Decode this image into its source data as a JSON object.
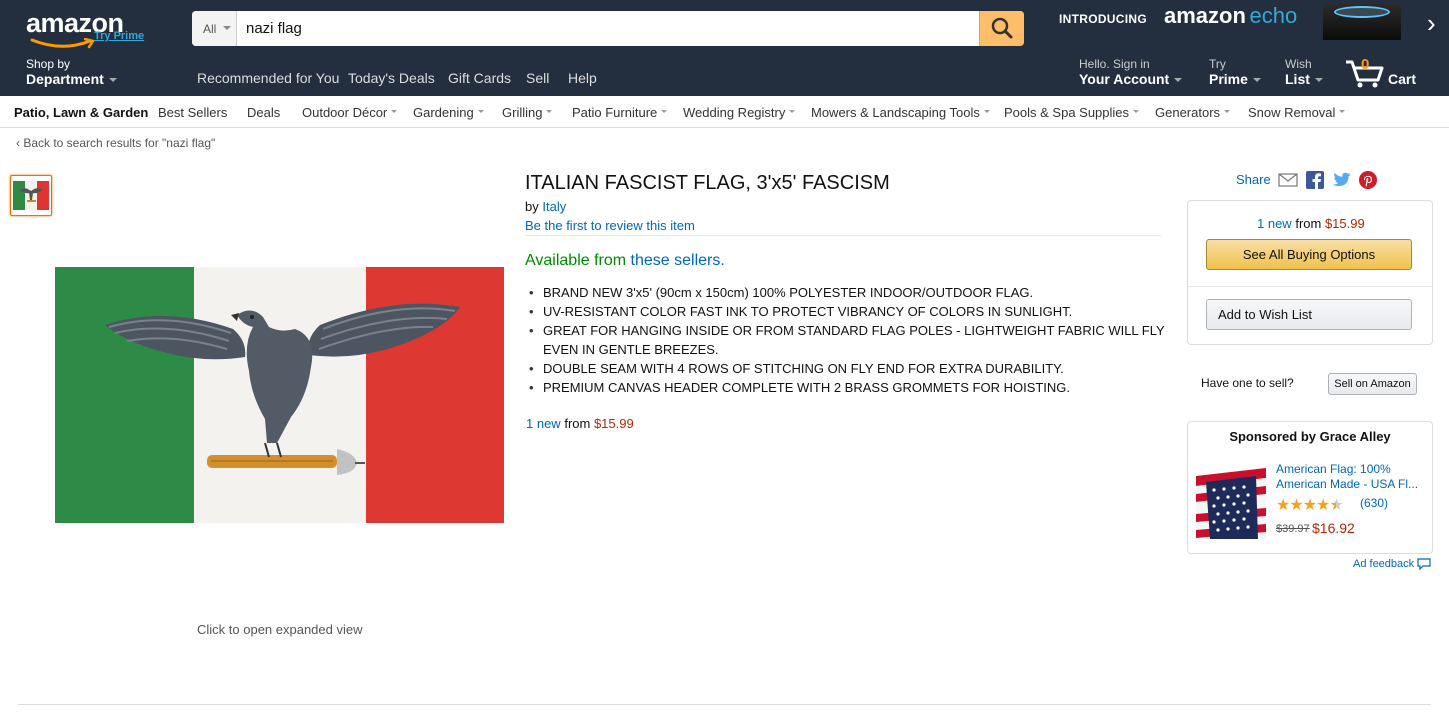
{
  "header": {
    "logo_text": "amazon",
    "logo_prime": "Try Prime",
    "search": {
      "scope": "All",
      "value": "nazi flag"
    },
    "promo": {
      "introducing": "INTRODUCING",
      "brand_1": "amazon",
      "brand_2": "echo",
      "arrow": "›"
    },
    "shop_by_small": "Shop by",
    "shop_by_big": "Department",
    "links": [
      "Recommended for You",
      "Today's Deals",
      "Gift Cards",
      "Sell",
      "Help"
    ],
    "account": {
      "small": "Hello. Sign in",
      "big": "Your Account"
    },
    "prime": {
      "small": "Try",
      "big": "Prime"
    },
    "wishlist": {
      "small": "Wish",
      "big": "List"
    },
    "cart": {
      "count": "0",
      "label": "Cart"
    }
  },
  "subnav": {
    "items": [
      {
        "label": "Patio, Lawn & Garden",
        "caret": false
      },
      {
        "label": "Best Sellers",
        "caret": false
      },
      {
        "label": "Deals",
        "caret": false
      },
      {
        "label": "Outdoor Décor",
        "caret": true
      },
      {
        "label": "Gardening",
        "caret": true
      },
      {
        "label": "Grilling",
        "caret": true
      },
      {
        "label": "Patio Furniture",
        "caret": true
      },
      {
        "label": "Wedding Registry",
        "caret": true
      },
      {
        "label": "Mowers & Landscaping Tools",
        "caret": true
      },
      {
        "label": "Pools & Spa Supplies",
        "caret": true
      },
      {
        "label": "Generators",
        "caret": true
      },
      {
        "label": "Snow Removal",
        "caret": true
      }
    ]
  },
  "breadcrumb": "‹  Back to search results for \"nazi flag\"",
  "product": {
    "title": "ITALIAN FASCIST FLAG, 3'x5' FASCISM",
    "by": "by",
    "brand": "Italy",
    "review_link": "Be the first to review this item",
    "availability_prefix": "Available from",
    "availability_link": "these sellers.",
    "bullets": [
      "BRAND NEW 3'x5' (90cm x 150cm) 100% POLYESTER INDOOR/OUTDOOR FLAG.",
      "UV-RESISTANT COLOR FAST INK TO PROTECT VIBRANCY OF COLORS IN SUNLIGHT.",
      "GREAT FOR HANGING INSIDE OR FROM STANDARD FLAG POLES - LIGHTWEIGHT FABRIC WILL FLY EVEN IN GENTLE BREEZES.",
      "DOUBLE SEAM WITH 4 ROWS OF STITCHING ON FLY END FOR EXTRA DURABILITY.",
      "PREMIUM CANVAS HEADER COMPLETE WITH 2 BRASS GROMMETS FOR HOISTING."
    ],
    "offer": {
      "count": "1 new",
      "from": "from",
      "price": "$15.99"
    },
    "expand_text": "Click to open expanded view"
  },
  "sidebar": {
    "share": "Share",
    "box_offer": {
      "count": "1 new",
      "from": "from",
      "price": "$15.99"
    },
    "see_all": "See All Buying Options",
    "wish": "Add to Wish List",
    "sell_question": "Have one to sell?",
    "sell_button": "Sell on Amazon",
    "ad": {
      "heading": "Sponsored by Grace Alley",
      "title": "American Flag: 100% American Made - USA Fl...",
      "rating": 4.5,
      "reviews": "(630)",
      "old_price": "$39.97",
      "new_price": "$16.92"
    },
    "ad_feedback": "Ad feedback"
  },
  "colors": {
    "header_bg": "#232f3e",
    "link": "#0066c0",
    "price": "#b12704",
    "availability": "#008a00",
    "cart_count": "#ff9900",
    "search_button": "#febd69"
  }
}
